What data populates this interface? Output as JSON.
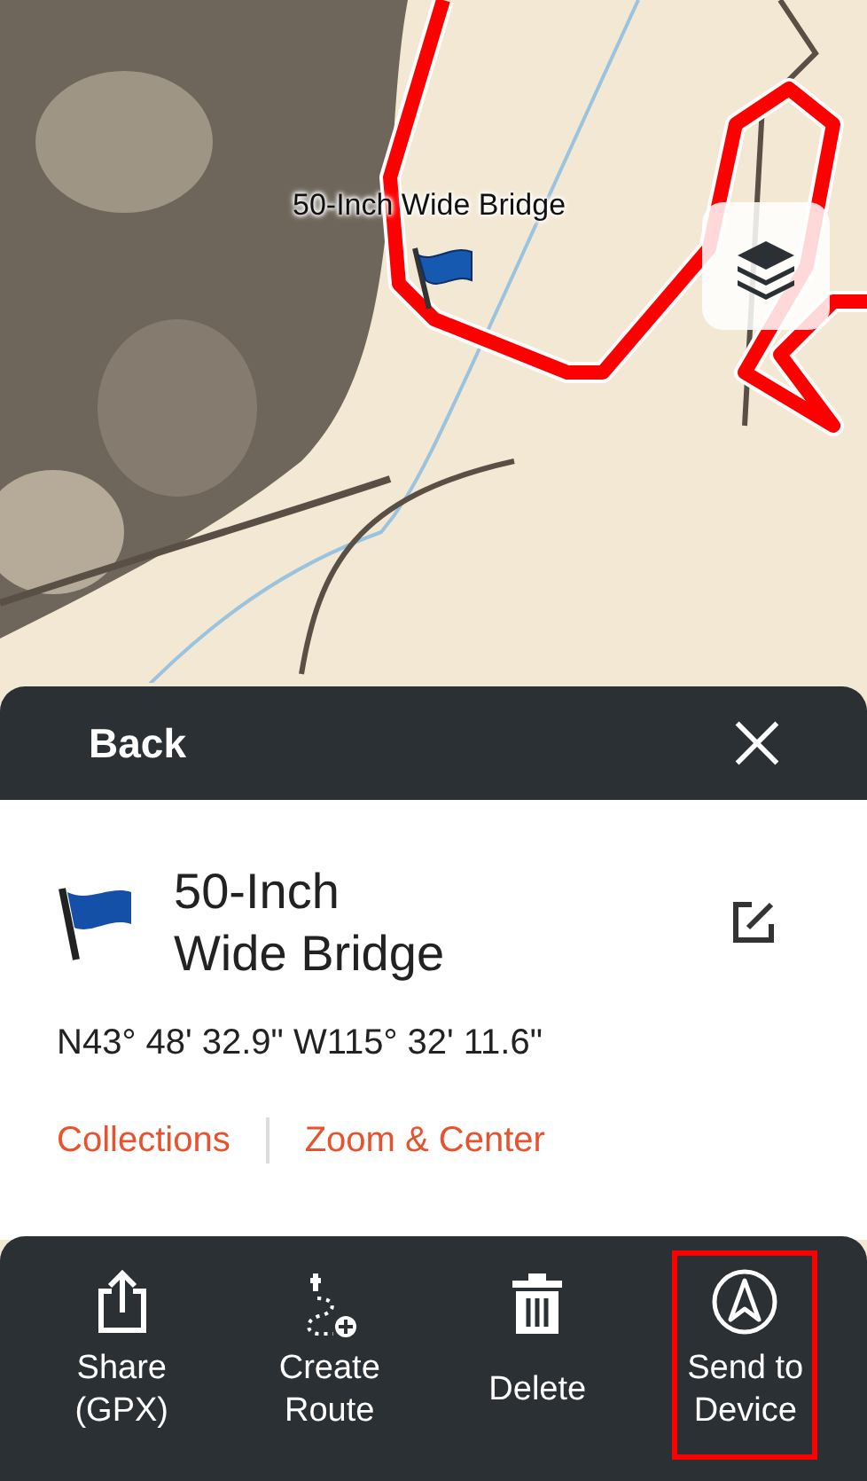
{
  "map": {
    "waypoint_label": "50-Inch Wide Bridge"
  },
  "panel": {
    "back": "Back",
    "name_lines": [
      "50-Inch",
      "Wide Bridge"
    ],
    "coordinates": "N43° 48' 32.9\" W115° 32' 11.6\"",
    "links": [
      "Collections",
      "Zoom & Center"
    ]
  },
  "actions": [
    {
      "kind": "share",
      "label_lines": [
        "Share",
        "(GPX)"
      ],
      "highlighted": false
    },
    {
      "kind": "route",
      "label_lines": [
        "Create",
        "Route"
      ],
      "highlighted": false
    },
    {
      "kind": "delete",
      "label_lines": [
        "Delete"
      ],
      "highlighted": false
    },
    {
      "kind": "send",
      "label_lines": [
        "Send to",
        "Device"
      ],
      "highlighted": true
    }
  ]
}
